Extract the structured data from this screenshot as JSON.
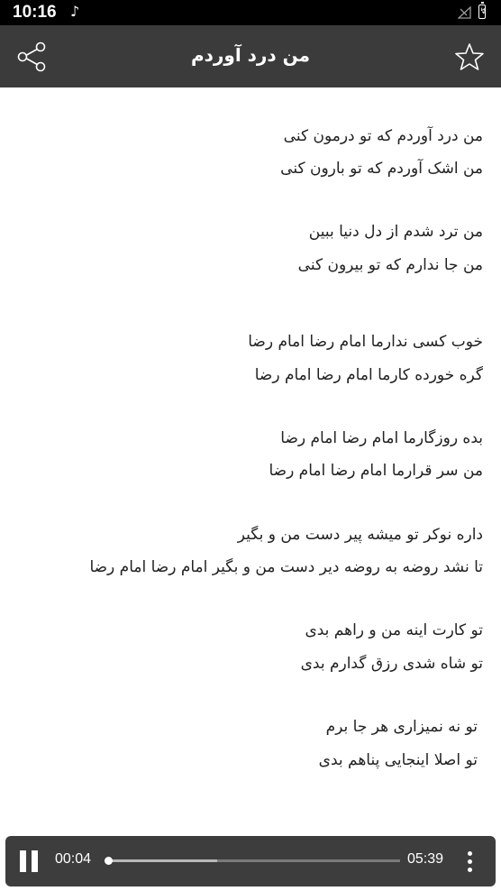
{
  "status_bar": {
    "time": "10:16"
  },
  "app_bar": {
    "title": "من درد آوردم"
  },
  "lyrics": [
    "من درد آوردم که تو درمون کنی",
    "من اشک آوردم که تو بارون کنی",
    "من ترد شدم از دل دنیا ببین",
    "من جا ندارم که تو بیرون کنی",
    "خوب کسی ندارما امام رضا امام رضا",
    "گره خورده کارما امام رضا امام رضا",
    "بده روزگارما امام رضا امام رضا",
    "من سر قرارما امام رضا امام رضا",
    "داره نوکر تو میشه پیر دست من و بگیر",
    "تا نشد روضه به روضه دیر دست من و بگیر امام رضا امام رضا",
    "تو کارت اینه من و راهم بدی",
    "تو شاه شدی رزق گدارم بدی",
    "تو نه نمیزاری هر جا برم",
    "تو اصلا اینجایی پناهم بدی"
  ],
  "player": {
    "elapsed": "00:04",
    "total": "05:39",
    "progress": 0.012,
    "buffered": 0.38
  },
  "colors": {
    "app_bar": "#3b3b3b",
    "player_bar": "#3d3d3d",
    "text": "#222222"
  }
}
